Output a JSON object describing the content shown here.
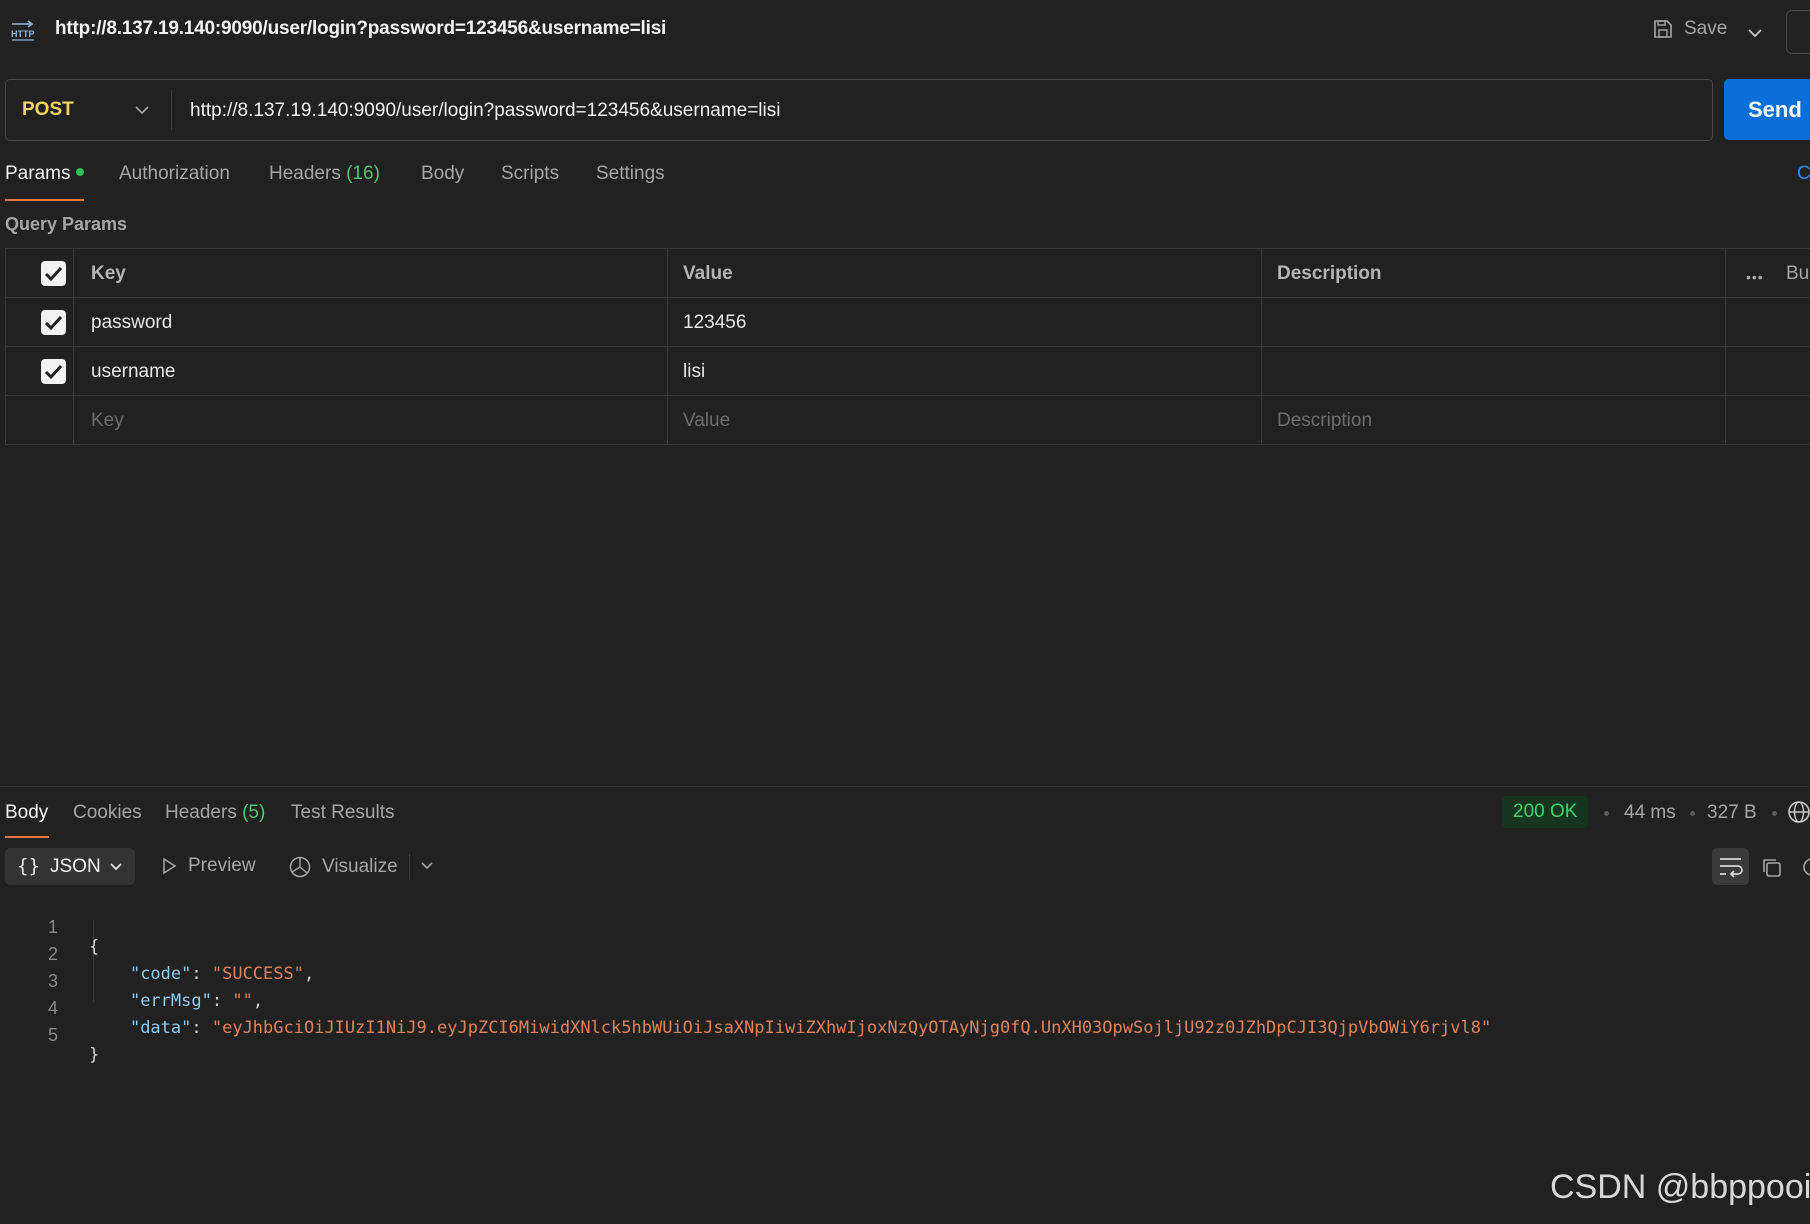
{
  "topbar": {
    "icon": "http-icon",
    "title": "http://8.137.19.140:9090/user/login?password=123456&username=lisi",
    "save_label": "Save"
  },
  "request": {
    "method": "POST",
    "url": "http://8.137.19.140:9090/user/login?password=123456&username=lisi",
    "send_label": "Send"
  },
  "tabs": {
    "params": "Params",
    "authorization": "Authorization",
    "headers": "Headers",
    "headers_count": "(16)",
    "body": "Body",
    "scripts": "Scripts",
    "settings": "Settings",
    "cookies_partial": "C"
  },
  "query_params": {
    "label": "Query Params",
    "headers": {
      "key": "Key",
      "value": "Value",
      "description": "Description",
      "bulk": "Bulk"
    },
    "rows": [
      {
        "key": "password",
        "value": "123456",
        "description": "",
        "checked": true
      },
      {
        "key": "username",
        "value": "lisi",
        "description": "",
        "checked": true
      }
    ],
    "placeholders": {
      "key": "Key",
      "value": "Value",
      "description": "Description"
    }
  },
  "response": {
    "tabs": {
      "body": "Body",
      "cookies": "Cookies",
      "headers": "Headers",
      "headers_count": "(5)",
      "test_results": "Test Results"
    },
    "status": "200 OK",
    "time": "44 ms",
    "size": "327 B",
    "format": "JSON",
    "preview": "Preview",
    "visualize": "Visualize",
    "lines": {
      "l1": "{",
      "l2_key": "\"code\"",
      "l2_val": "\"SUCCESS\"",
      "l3_key": "\"errMsg\"",
      "l3_val": "\"\"",
      "l4_key": "\"data\"",
      "l4_val": "\"eyJhbGciOiJIUzI1NiJ9.eyJpZCI6MiwidXNlck5hbWUiOiJsaXNpIiwiZXhwIjoxNzQyOTAyNjg0fQ.UnXH03OpwSojljU92z0JZhDpCJI3QjpVbOWiY6rjvl8\"",
      "l5": "}"
    }
  },
  "watermark": "CSDN @bbppooi",
  "colors": {
    "background": "#212121",
    "method": "#f4d35e",
    "send": "#0b6fd9",
    "active_tab_underline": "#e8743b",
    "status_ok": "#3fd46a",
    "json_key": "#8fcaf2",
    "json_string": "#e0825a"
  }
}
